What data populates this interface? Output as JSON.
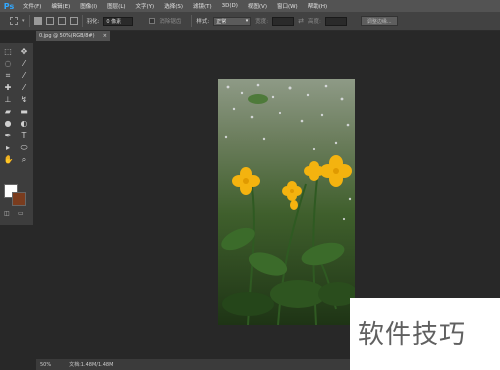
{
  "app": {
    "logo": "Ps"
  },
  "menu": [
    "文件(F)",
    "编辑(E)",
    "图像(I)",
    "图层(L)",
    "文字(Y)",
    "选择(S)",
    "滤镜(T)",
    "3D(D)",
    "视图(V)",
    "窗口(W)",
    "帮助(H)"
  ],
  "options": {
    "feather_label": "羽化:",
    "feather_value": "0 像素",
    "antialias_label": "消除锯齿",
    "style_label": "样式:",
    "style_value": "正常",
    "width_label": "宽度:",
    "height_label": "高度:",
    "refine_edge": "调整边缘..."
  },
  "document": {
    "tab_title": "0.jpg @ 50%(RGB/8#)",
    "tab_close": "×"
  },
  "status": {
    "zoom": "50%",
    "doc_info": "文档:1.48M/1.48M"
  },
  "colors": {
    "foreground": "#ffffff",
    "background": "#7a3c1e",
    "accent": "#31a8ff"
  },
  "tools": [
    "marquee-icon",
    "move-icon",
    "lasso-icon",
    "magic-wand-icon",
    "crop-icon",
    "eyedropper-icon",
    "healing-icon",
    "brush-icon",
    "stamp-icon",
    "history-brush-icon",
    "eraser-icon",
    "gradient-icon",
    "blur-icon",
    "dodge-icon",
    "pen-icon",
    "type-icon",
    "path-select-icon",
    "shape-icon",
    "hand-icon",
    "zoom-icon"
  ],
  "watermark": "软件技巧"
}
